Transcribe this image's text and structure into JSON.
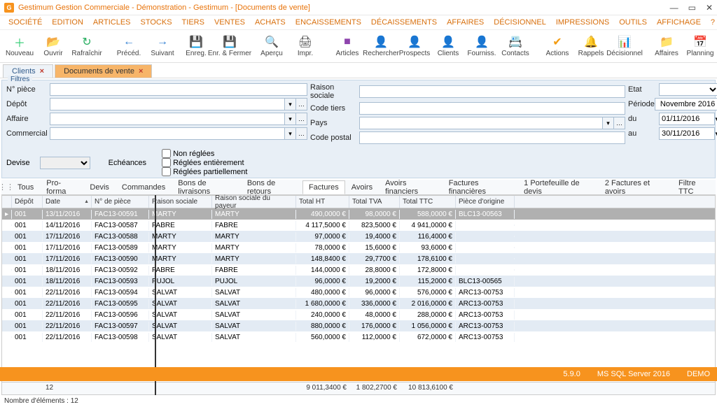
{
  "window": {
    "title": "Gestimum Gestion Commerciale - Démonstration - Gestimum - [Documents de vente]"
  },
  "menu": [
    "SOCIÉTÉ",
    "EDITION",
    "ARTICLES",
    "STOCKS",
    "TIERS",
    "VENTES",
    "ACHATS",
    "ENCAISSEMENTS",
    "DÉCAISSEMENTS",
    "AFFAIRES",
    "DÉCISIONNEL",
    "IMPRESSIONS",
    "OUTILS",
    "AFFICHAGE",
    "?"
  ],
  "toolbar": [
    {
      "label": "Nouveau",
      "icon": "＋",
      "color": "#2ecc71"
    },
    {
      "label": "Ouvrir",
      "icon": "📂",
      "color": "#e8730a"
    },
    {
      "label": "Rafraîchir",
      "icon": "↻",
      "color": "#27ae60"
    },
    {
      "sep": true
    },
    {
      "label": "Précéd.",
      "icon": "←",
      "color": "#2d7dd2"
    },
    {
      "label": "Suivant",
      "icon": "→",
      "color": "#2d7dd2"
    },
    {
      "label": "Enreg.",
      "icon": "💾",
      "color": "#888"
    },
    {
      "label": "Enr. & Fermer",
      "icon": "💾",
      "color": "#888"
    },
    {
      "sep": true
    },
    {
      "label": "Aperçu",
      "icon": "🔍",
      "color": "#444"
    },
    {
      "label": "Impr.",
      "icon": "🖨",
      "color": "#444"
    },
    {
      "sep": true
    },
    {
      "label": "Articles",
      "icon": "■",
      "color": "#8e44ad"
    },
    {
      "label": "Rechercher",
      "icon": "👤",
      "color": "#2d7dd2"
    },
    {
      "label": "Prospects",
      "icon": "👤",
      "color": "#e74c3c"
    },
    {
      "label": "Clients",
      "icon": "👤",
      "color": "#e67e22"
    },
    {
      "label": "Fourniss.",
      "icon": "👤",
      "color": "#16a085"
    },
    {
      "label": "Contacts",
      "icon": "📇",
      "color": "#2d7dd2"
    },
    {
      "sep": true
    },
    {
      "label": "Actions",
      "icon": "✔",
      "color": "#f39c12"
    },
    {
      "label": "Rappels",
      "icon": "🔔",
      "color": "#7f8c8d"
    },
    {
      "label": "Décisionnel",
      "icon": "📊",
      "color": "#2d7dd2"
    },
    {
      "sep": true
    },
    {
      "label": "Affaires",
      "icon": "📁",
      "color": "#e8a33d"
    },
    {
      "label": "Planning",
      "icon": "📅",
      "color": "#2d7dd2"
    }
  ],
  "docTabs": [
    {
      "label": "Clients",
      "active": false
    },
    {
      "label": "Documents de vente",
      "active": true
    }
  ],
  "filters": {
    "legend": "Filtres",
    "left": [
      {
        "label": "N° pièce",
        "type": "text"
      },
      {
        "label": "Dépôt",
        "type": "combo"
      },
      {
        "label": "Affaire",
        "type": "combo"
      },
      {
        "label": "Commercial",
        "type": "combo"
      }
    ],
    "mid": [
      {
        "label": "Raison sociale",
        "type": "text"
      },
      {
        "label": "Code tiers",
        "type": "text"
      },
      {
        "label": "Pays",
        "type": "combo"
      },
      {
        "label": "Code postal",
        "type": "text"
      }
    ],
    "right": {
      "etat": {
        "label": "Etat",
        "value": ""
      },
      "periode": {
        "label": "Période",
        "value": "Novembre 2016"
      },
      "du": {
        "label": "du",
        "value": "01/11/2016"
      },
      "au": {
        "label": "au",
        "value": "30/11/2016"
      }
    },
    "devise": {
      "label": "Devise",
      "value": ""
    },
    "echeances": "Echéances",
    "checks": [
      "Non réglées",
      "Réglées entièrement",
      "Réglées partiellement"
    ]
  },
  "subTabs": [
    "Tous",
    "Pro-forma",
    "Devis",
    "Commandes",
    "Bons de livraisons",
    "Bons de retours",
    "Factures",
    "Avoirs",
    "Avoirs financiers",
    "Factures financières",
    "1 Portefeuille de devis",
    "2 Factures et avoirs",
    "Filtre TTC"
  ],
  "subActive": "Factures",
  "columns": [
    "",
    "Dépôt",
    "Date",
    "N° de pièce",
    "Raison sociale",
    "Raison sociale du payeur",
    "Total HT",
    "Total TVA",
    "Total TTC",
    "Pièce d'origine"
  ],
  "rows": [
    {
      "sel": true,
      "depot": "001",
      "date": "13/11/2016",
      "piece": "FAC13-00591",
      "rs": "MARTY",
      "payer": "MARTY",
      "ht": "490,0000 €",
      "tva": "98,0000 €",
      "ttc": "588,0000 €",
      "orig": "BLC13-00563"
    },
    {
      "depot": "001",
      "date": "14/11/2016",
      "piece": "FAC13-00587",
      "rs": "FABRE",
      "payer": "FABRE",
      "ht": "4 117,5000 €",
      "tva": "823,5000 €",
      "ttc": "4 941,0000 €",
      "orig": ""
    },
    {
      "depot": "001",
      "date": "17/11/2016",
      "piece": "FAC13-00588",
      "rs": "MARTY",
      "payer": "MARTY",
      "ht": "97,0000 €",
      "tva": "19,4000 €",
      "ttc": "116,4000 €",
      "orig": ""
    },
    {
      "depot": "001",
      "date": "17/11/2016",
      "piece": "FAC13-00589",
      "rs": "MARTY",
      "payer": "MARTY",
      "ht": "78,0000 €",
      "tva": "15,6000 €",
      "ttc": "93,6000 €",
      "orig": ""
    },
    {
      "depot": "001",
      "date": "17/11/2016",
      "piece": "FAC13-00590",
      "rs": "MARTY",
      "payer": "MARTY",
      "ht": "148,8400 €",
      "tva": "29,7700 €",
      "ttc": "178,6100 €",
      "orig": ""
    },
    {
      "depot": "001",
      "date": "18/11/2016",
      "piece": "FAC13-00592",
      "rs": "FABRE",
      "payer": "FABRE",
      "ht": "144,0000 €",
      "tva": "28,8000 €",
      "ttc": "172,8000 €",
      "orig": ""
    },
    {
      "depot": "001",
      "date": "18/11/2016",
      "piece": "FAC13-00593",
      "rs": "PUJOL",
      "payer": "PUJOL",
      "ht": "96,0000 €",
      "tva": "19,2000 €",
      "ttc": "115,2000 €",
      "orig": "BLC13-00565"
    },
    {
      "depot": "001",
      "date": "22/11/2016",
      "piece": "FAC13-00594",
      "rs": "SALVAT",
      "payer": "SALVAT",
      "ht": "480,0000 €",
      "tva": "96,0000 €",
      "ttc": "576,0000 €",
      "orig": "ARC13-00753"
    },
    {
      "depot": "001",
      "date": "22/11/2016",
      "piece": "FAC13-00595",
      "rs": "SALVAT",
      "payer": "SALVAT",
      "ht": "1 680,0000 €",
      "tva": "336,0000 €",
      "ttc": "2 016,0000 €",
      "orig": "ARC13-00753"
    },
    {
      "depot": "001",
      "date": "22/11/2016",
      "piece": "FAC13-00596",
      "rs": "SALVAT",
      "payer": "SALVAT",
      "ht": "240,0000 €",
      "tva": "48,0000 €",
      "ttc": "288,0000 €",
      "orig": "ARC13-00753"
    },
    {
      "depot": "001",
      "date": "22/11/2016",
      "piece": "FAC13-00597",
      "rs": "SALVAT",
      "payer": "SALVAT",
      "ht": "880,0000 €",
      "tva": "176,0000 €",
      "ttc": "1 056,0000 €",
      "orig": "ARC13-00753"
    },
    {
      "depot": "001",
      "date": "22/11/2016",
      "piece": "FAC13-00598",
      "rs": "SALVAT",
      "payer": "SALVAT",
      "ht": "560,0000 €",
      "tva": "112,0000 €",
      "ttc": "672,0000 €",
      "orig": "ARC13-00753"
    }
  ],
  "totals": {
    "count": "12",
    "ht": "9 011,3400 €",
    "tva": "1 802,2700 €",
    "ttc": "10 813,6100 €"
  },
  "countLabel": "Nombre d'éléments : 12",
  "status": {
    "version": "5.9.0",
    "db": "MS SQL Server 2016",
    "user": "DEMO"
  }
}
